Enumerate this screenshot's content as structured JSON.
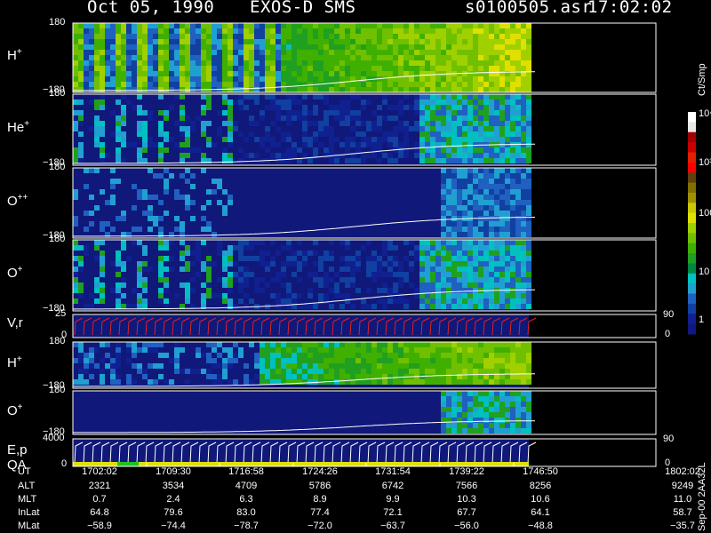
{
  "header": {
    "date": "Oct 05, 1990",
    "instrument": "EXOS-D SMS",
    "file": "s0100505.asr",
    "time": "17:02:02"
  },
  "side_label": "Sep-00  2AA32L",
  "colorbar": {
    "unit": "Ct/Smp",
    "labels": [
      "10⁴",
      "10³",
      "100",
      "10",
      "1"
    ],
    "colors": [
      "#ffffff",
      "#e8e8e8",
      "#a00000",
      "#c80000",
      "#e02000",
      "#ff0000",
      "#604010",
      "#807000",
      "#a09000",
      "#c8c800",
      "#e0e000",
      "#a0d000",
      "#70c000",
      "#40b000",
      "#20a020",
      "#008840",
      "#00c0c0",
      "#20a0d0",
      "#2060c0",
      "#1040a0",
      "#102090",
      "#101880"
    ]
  },
  "panels": [
    {
      "label": "H",
      "sup": "+",
      "ymax": "180",
      "ymin": "−180",
      "intensity": "high"
    },
    {
      "label": "He",
      "sup": "+",
      "ymax": "180",
      "ymin": "−180",
      "intensity": "med"
    },
    {
      "label": "O",
      "sup": "++",
      "ymax": "180",
      "ymin": "−180",
      "intensity": "low"
    },
    {
      "label": "O",
      "sup": "+",
      "ymax": "180",
      "ymin": "−180",
      "intensity": "med"
    },
    {
      "label": "V,r",
      "sup": "",
      "ymax": "25",
      "ymin": "0",
      "right_top": "90",
      "right_bottom": "0"
    },
    {
      "label": "H",
      "sup": "+",
      "ymax": "180",
      "ymin": "−180",
      "intensity": "med2"
    },
    {
      "label": "O",
      "sup": "+",
      "ymax": "180",
      "ymin": "−180",
      "intensity": "low2"
    },
    {
      "label": "E,p",
      "sup": "",
      "label2": "QA",
      "ymax": "4000",
      "ymin": "0",
      "right_top": "90",
      "right_bottom": "0"
    }
  ],
  "ephemeris": {
    "names": [
      "UT",
      "ALT",
      "MLT",
      "InLat",
      "MLat"
    ],
    "columns": [
      {
        "UT": "1702:02",
        "ALT": "2321",
        "MLT": "0.7",
        "InLat": "64.8",
        "MLat": "−58.9"
      },
      {
        "UT": "1709:30",
        "ALT": "3534",
        "MLT": "2.4",
        "InLat": "79.6",
        "MLat": "−74.4"
      },
      {
        "UT": "1716:58",
        "ALT": "4709",
        "MLT": "6.3",
        "InLat": "83.0",
        "MLat": "−78.7"
      },
      {
        "UT": "1724:26",
        "ALT": "5786",
        "MLT": "8.9",
        "InLat": "77.4",
        "MLat": "−72.0"
      },
      {
        "UT": "1731:54",
        "ALT": "6742",
        "MLT": "9.9",
        "InLat": "72.1",
        "MLat": "−63.7"
      },
      {
        "UT": "1739:22",
        "ALT": "7566",
        "MLT": "10.3",
        "InLat": "67.7",
        "MLat": "−56.0"
      },
      {
        "UT": "1746:50",
        "ALT": "8256",
        "MLT": "10.6",
        "InLat": "64.1",
        "MLat": "−48.8"
      },
      {
        "UT": "1802:02",
        "ALT": "9249",
        "MLT": "11.0",
        "InLat": "58.7",
        "MLat": "−35.7"
      }
    ]
  },
  "chart_data": {
    "type": "heatmap",
    "x_ticks": [
      "1702:02",
      "1709:30",
      "1716:58",
      "1724:26",
      "1731:54",
      "1739:22",
      "1746:50",
      "1802:02"
    ],
    "x_range": [
      "1702:02",
      "1802:02"
    ],
    "data_end": "1749:40",
    "y_range_pitch": [
      -180,
      180
    ],
    "panel_series": [
      "H+",
      "He+",
      "O++",
      "O+",
      "V,r",
      "H+",
      "O+",
      "E,p"
    ],
    "legend_placement": "right colorbar"
  }
}
